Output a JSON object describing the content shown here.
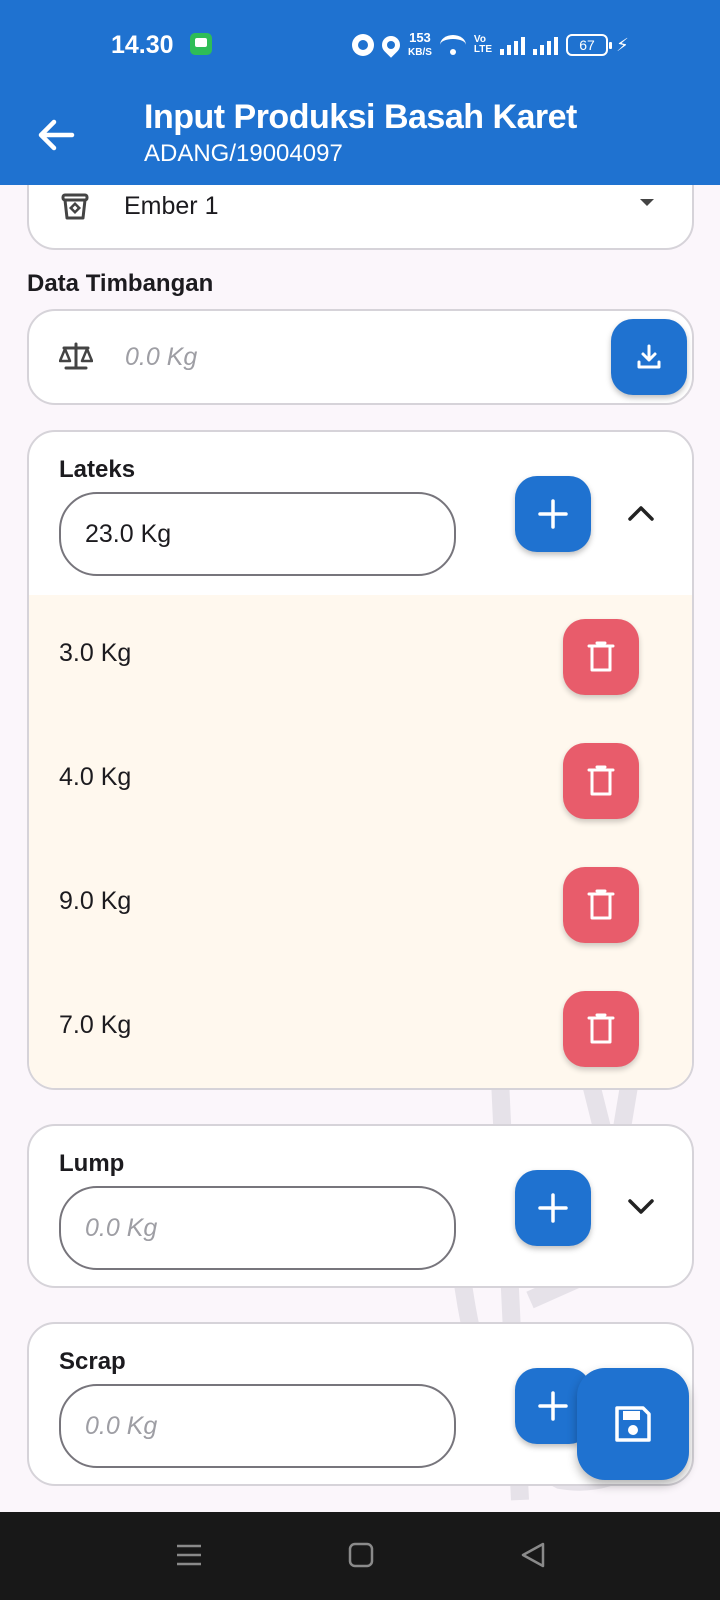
{
  "status_bar": {
    "time": "14.30",
    "net_speed_value": "153",
    "net_speed_unit": "KB/S",
    "volte_top": "Vo",
    "volte_bottom": "LTE",
    "battery": "67"
  },
  "app_bar": {
    "title": "Input Produksi Basah Karet",
    "subtitle": "ADANG/19004097",
    "back_icon": "arrow-left-icon"
  },
  "container_select": {
    "value": "Ember 1",
    "icon": "bucket-icon",
    "dropdown_icon": "caret-down-icon"
  },
  "data_timbangan": {
    "label": "Data Timbangan",
    "placeholder": "0.0 Kg",
    "icon": "scale-icon",
    "button_icon": "download-icon"
  },
  "sections": [
    {
      "label": "Lateks",
      "total": "23.0 Kg",
      "expanded": true,
      "entries": [
        "3.0 Kg",
        "4.0 Kg",
        "9.0 Kg",
        "7.0 Kg"
      ]
    },
    {
      "label": "Lump",
      "placeholder": "0.0 Kg",
      "expanded": false
    },
    {
      "label": "Scrap",
      "placeholder": "0.0 Kg",
      "expanded": false
    }
  ],
  "save_fab": {
    "icon": "save-icon"
  },
  "colors": {
    "primary": "#1f72d0",
    "delete": "#e85c6b",
    "entries_bg": "#fff8ee",
    "page_bg": "#fbf6fb"
  }
}
